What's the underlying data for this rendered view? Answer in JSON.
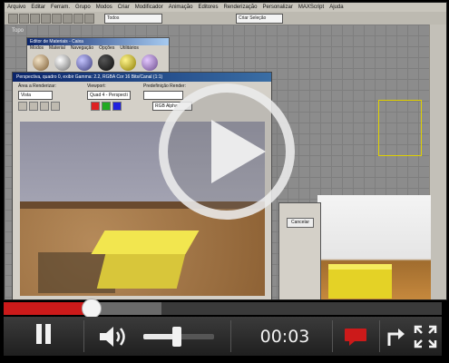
{
  "max": {
    "menu": [
      "Arquivo",
      "Editar",
      "Ferram.",
      "Grupo",
      "Modos",
      "Criar",
      "Modificador",
      "Animação",
      "Editores",
      "Renderização",
      "Personalizar",
      "MAXScript",
      "Ajuda"
    ],
    "selection_set": "Todos",
    "view_dropdown": "Criar Seleção",
    "viewport_label": "Topo"
  },
  "material_editor": {
    "title": "Editor de Materiais - Caixa",
    "menu": [
      "Modos",
      "Material",
      "Navegação",
      "Opções",
      "Utilitários"
    ]
  },
  "render_window": {
    "title": "Perspectiva, quadro 0, exibir Gamma: 2.2, RGBA Cor 16 Bits/Canal (1:1)",
    "area_label": "Área a Renderizar:",
    "area_value": "Vista",
    "viewport_label": "Viewport:",
    "viewport_value": "Quad 4 - Perspecti",
    "preset_label": "Predefinição Render:",
    "channel_value": "RGB Alpha"
  },
  "dialog": {
    "button": "Cancelar"
  },
  "player": {
    "time": "00:03",
    "progress": 0.2,
    "loaded": 0.36,
    "volume": 0.48,
    "colors": {
      "accent": "#cc1a1a",
      "bar": "#2a2a2a"
    },
    "icons": [
      "play-icon",
      "pause-icon",
      "volume-icon",
      "captions-icon",
      "share-icon",
      "fullscreen-icon"
    ]
  }
}
